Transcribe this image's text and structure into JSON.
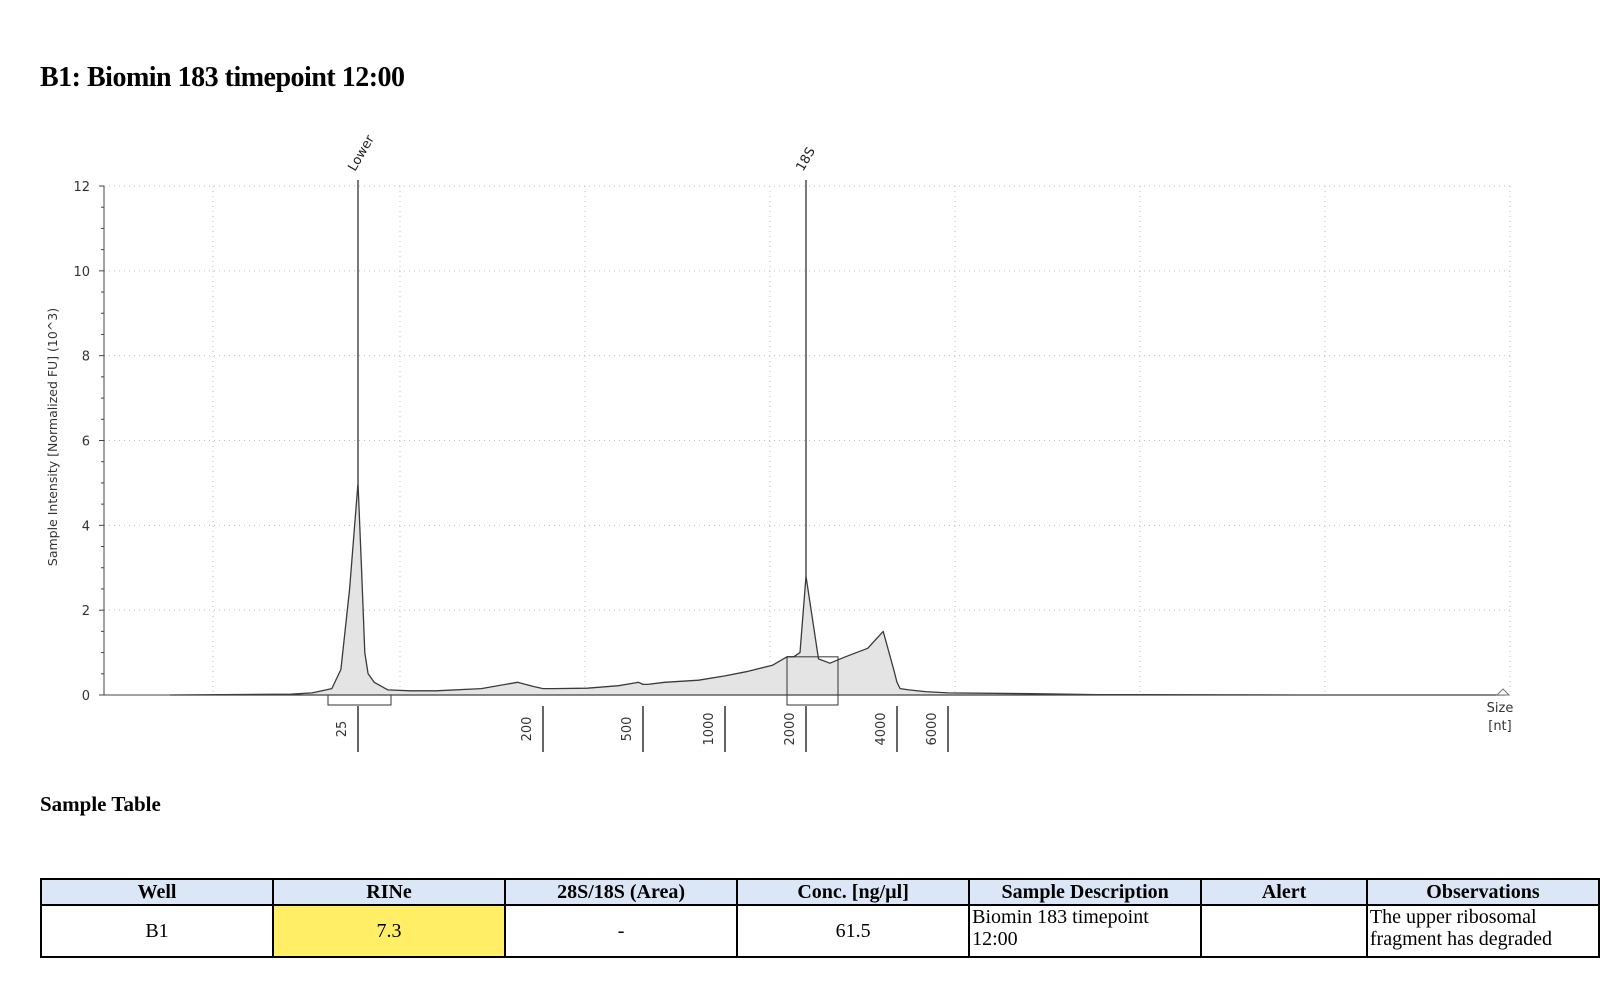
{
  "page_title": "B1: Biomin 183 timepoint 12:00",
  "chart_data": {
    "type": "area",
    "title": "",
    "ylabel": "Sample Intensity [Normalized FU] (10^3)",
    "xlabel": "Size\n[nt]",
    "xlabel_lines": [
      "Size",
      "[nt]"
    ],
    "ylim": [
      0,
      12
    ],
    "y_ticks": [
      0,
      2,
      4,
      6,
      8,
      10,
      12
    ],
    "y_tick_labels": [
      "0",
      "2",
      "4",
      "6",
      "8",
      "10",
      "12"
    ],
    "x_scale": "log (electropherogram size ladder)",
    "x_ticks": [
      25,
      200,
      500,
      1000,
      2000,
      4000,
      6000
    ],
    "x_tick_labels": [
      "25",
      "200",
      "500",
      "1000",
      "2000",
      "4000",
      "6000"
    ],
    "grid": true,
    "peak_labels": [
      {
        "label": "Lower",
        "size": 25,
        "value": 5.0
      },
      {
        "label": "18S",
        "size": 2000,
        "value": 2.8
      }
    ],
    "series": [
      {
        "x": [
          10,
          18,
          20,
          22,
          23,
          24,
          25,
          26,
          27,
          28,
          30,
          35,
          45,
          60,
          100,
          150,
          180,
          200,
          220,
          300,
          400,
          480,
          500,
          520,
          600,
          800,
          1000,
          1200,
          1500,
          1700,
          1800,
          1900,
          2000,
          2100,
          2200,
          2400,
          2700,
          3200,
          3600,
          3900,
          4000,
          4100,
          4400,
          5000,
          6000,
          8000,
          10000,
          20000
        ],
        "y": [
          0.0,
          0.02,
          0.05,
          0.15,
          0.6,
          2.5,
          5.0,
          3.0,
          1.0,
          0.5,
          0.3,
          0.12,
          0.1,
          0.1,
          0.15,
          0.3,
          0.2,
          0.15,
          0.15,
          0.16,
          0.22,
          0.3,
          0.25,
          0.25,
          0.3,
          0.35,
          0.45,
          0.55,
          0.7,
          0.9,
          0.9,
          1.0,
          2.8,
          1.8,
          0.85,
          0.75,
          0.9,
          1.1,
          1.5,
          0.6,
          0.3,
          0.15,
          0.12,
          0.08,
          0.05,
          0.03,
          0.01,
          0.0
        ]
      }
    ]
  },
  "table": {
    "title": "Sample Table",
    "headers": [
      "Well",
      "RINe",
      "28S/18S (Area)",
      "Conc. [ng/µl]",
      "Sample Description",
      "Alert",
      "Observations"
    ],
    "rows": [
      {
        "well": "B1",
        "rine": "7.3",
        "ratio": "-",
        "conc": "61.5",
        "description": "Biomin 183 timepoint 12:00",
        "alert": "",
        "observations": "The upper ribosomal fragment has degraded"
      }
    ]
  },
  "colors": {
    "area_fill": "#e4e4e4",
    "line": "#3a3a3a",
    "header_bg": "#dbe7f6",
    "rine_highlight": "#ffee66"
  }
}
